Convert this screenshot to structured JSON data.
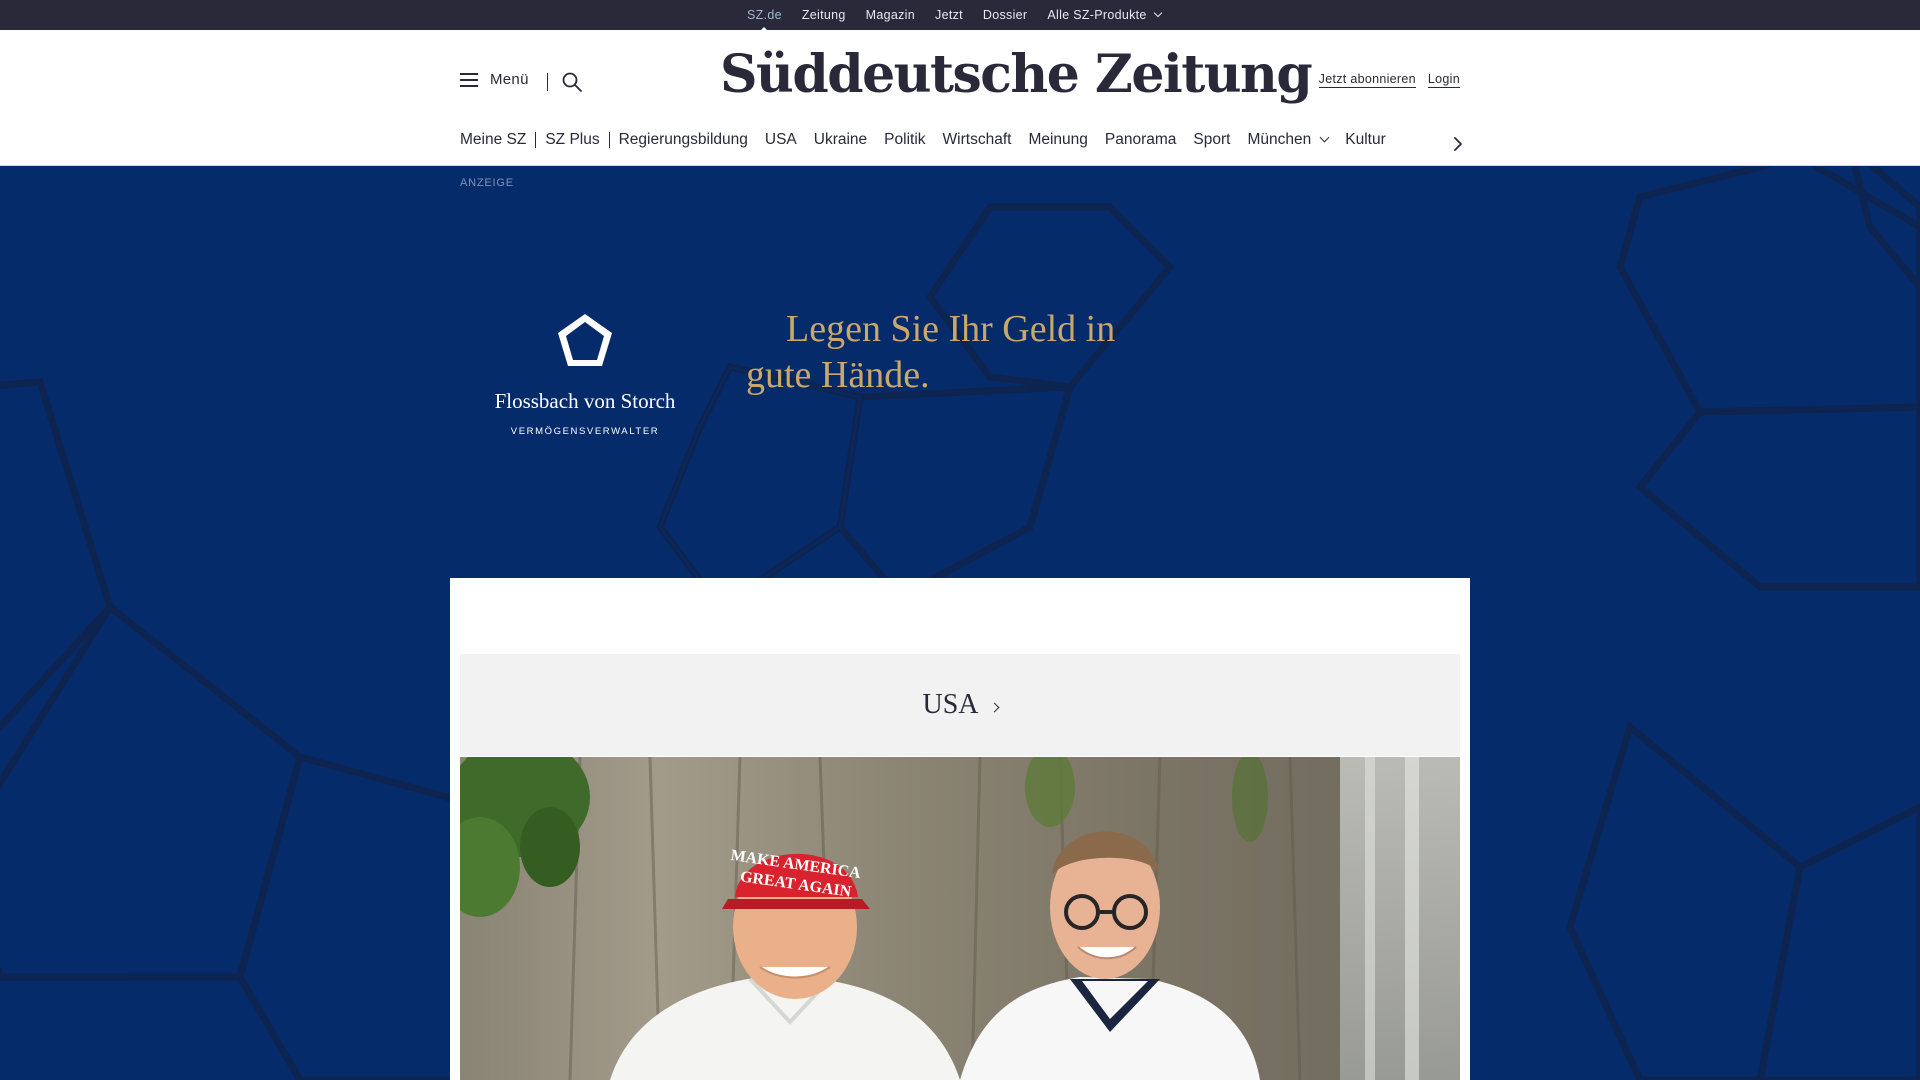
{
  "topbar": {
    "items": [
      {
        "label": "SZ.de",
        "active": true
      },
      {
        "label": "Zeitung"
      },
      {
        "label": "Magazin"
      },
      {
        "label": "Jetzt"
      },
      {
        "label": "Dossier"
      },
      {
        "label": "Alle SZ-Produkte",
        "dropdown": true
      }
    ]
  },
  "header": {
    "menu_label": "Menü",
    "logo_text": "Süddeutsche Zeitung",
    "subscribe_label": "Jetzt abonnieren",
    "login_label": "Login"
  },
  "nav": {
    "items": [
      "Meine SZ",
      "SZ Plus",
      "Regierungsbildung",
      "USA",
      "Ukraine",
      "Politik",
      "Wirtschaft",
      "Meinung",
      "Panorama",
      "Sport",
      "München",
      "Kultur"
    ]
  },
  "ad": {
    "label": "ANZEIGE",
    "brand_name": "Flossbach von Storch",
    "brand_sub": "VERMÖGENSVERWALTER",
    "headline": "Legen Sie Ihr Geld in gute Hände."
  },
  "section": {
    "title": "USA"
  },
  "photo": {
    "cap_text_1": "MAKE AMERICA",
    "cap_text_2": "GREAT AGAIN"
  },
  "colors": {
    "topbar": "#29293a",
    "ad_background": "#062b6a",
    "ad_gold": "#c9a86a",
    "section_bg": "#f2f2f2",
    "cap_red": "#d8232f"
  },
  "icons": [
    "hamburger-icon",
    "search-icon",
    "chevron-down-icon",
    "chevron-right-icon",
    "pentagon-logo-icon"
  ]
}
